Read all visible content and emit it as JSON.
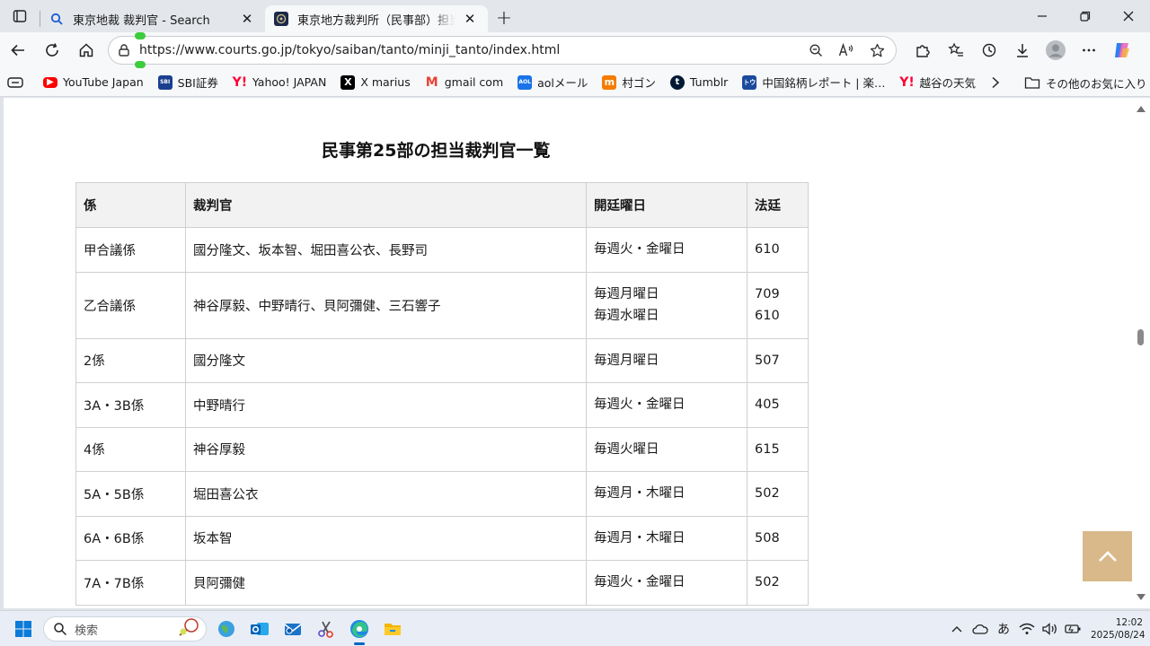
{
  "browser": {
    "tabs": [
      {
        "title": "東京地裁 裁判官 - Search",
        "active": false,
        "icon": "search-favicon"
      },
      {
        "title": "東京地方裁判所（民事部）担当裁判官一覧",
        "active": true,
        "icon": "court-favicon"
      }
    ],
    "url": "https://www.courts.go.jp/tokyo/saiban/tanto/minji_tanto/index.html",
    "bookmarks": [
      {
        "label": "YouTube Japan",
        "icon": "youtube-icon",
        "color": "#ff0000"
      },
      {
        "label": "SBI証券",
        "icon": "sbi-icon",
        "color": "#1a3f8f"
      },
      {
        "label": "Yahoo! JAPAN",
        "icon": "yahoo-icon",
        "color": "#ff0033"
      },
      {
        "label": "X marius",
        "icon": "x-icon",
        "color": "#000000"
      },
      {
        "label": "gmail com",
        "icon": "gmail-icon",
        "color": "#ea4335"
      },
      {
        "label": "aolメール",
        "icon": "aol-icon",
        "color": "#1a73e8"
      },
      {
        "label": "村ゴン",
        "icon": "muragon-icon",
        "color": "#f57c00"
      },
      {
        "label": "Tumblr",
        "icon": "tumblr-icon",
        "color": "#001935"
      },
      {
        "label": "中国銘柄レポート | 楽…",
        "icon": "rakuten-icon",
        "color": "#1c4a9c"
      },
      {
        "label": "越谷の天気",
        "icon": "yahoo-weather-icon",
        "color": "#ff0033"
      }
    ],
    "other_bookmarks": "その他のお気に入り"
  },
  "page": {
    "heading": "民事第25部の担当裁判官一覧",
    "table": {
      "headers": [
        "係",
        "裁判官",
        "開廷曜日",
        "法廷"
      ],
      "rows": [
        {
          "kakari": "甲合議係",
          "judges": "國分隆文、坂本智、堀田喜公衣、長野司",
          "days": [
            "毎週火・金曜日"
          ],
          "rooms": [
            "610"
          ]
        },
        {
          "kakari": "乙合議係",
          "judges": "神谷厚毅、中野晴行、貝阿彌健、三石響子",
          "days": [
            "毎週月曜日",
            "毎週水曜日"
          ],
          "rooms": [
            "709",
            "610"
          ]
        },
        {
          "kakari": "2係",
          "judges": "國分隆文",
          "days": [
            "毎週月曜日"
          ],
          "rooms": [
            "507"
          ]
        },
        {
          "kakari": "3A・3B係",
          "judges": "中野晴行",
          "days": [
            "毎週火・金曜日"
          ],
          "rooms": [
            "405"
          ]
        },
        {
          "kakari": "4係",
          "judges": "神谷厚毅",
          "days": [
            "毎週火曜日"
          ],
          "rooms": [
            "615"
          ]
        },
        {
          "kakari": "5A・5B係",
          "judges": "堀田喜公衣",
          "days": [
            "毎週月・木曜日"
          ],
          "rooms": [
            "502"
          ]
        },
        {
          "kakari": "6A・6B係",
          "judges": "坂本智",
          "days": [
            "毎週月・木曜日"
          ],
          "rooms": [
            "508"
          ]
        },
        {
          "kakari": "7A・7B係",
          "judges": "貝阿彌健",
          "days": [
            "毎週火・金曜日"
          ],
          "rooms": [
            "502"
          ]
        }
      ]
    },
    "back_to_top_color": "#d9b98a"
  },
  "taskbar": {
    "search_placeholder": "検索",
    "ime": "あ",
    "time": "12:02",
    "date": "2025/08/24"
  }
}
